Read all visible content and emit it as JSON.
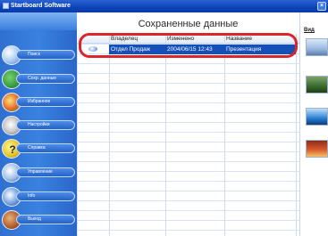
{
  "window": {
    "title": "Startboard Software",
    "close_label": "×"
  },
  "sidebar": {
    "items": [
      {
        "label": "Поиск",
        "icon": "search-icon"
      },
      {
        "label": "Сохр. данные",
        "icon": "saved-data-icon"
      },
      {
        "label": "Избранное",
        "icon": "favorites-icon"
      },
      {
        "label": "Настройки",
        "icon": "settings-icon"
      },
      {
        "label": "Справка",
        "icon": "help-icon",
        "glyph": "?"
      },
      {
        "label": "Управление",
        "icon": "manage-icon"
      },
      {
        "label": "Info",
        "icon": "info-icon"
      },
      {
        "label": "Выход",
        "icon": "exit-icon"
      }
    ]
  },
  "main": {
    "title": "Сохраненные данные",
    "columns": [
      "Владелец",
      "Изменено",
      "Название"
    ],
    "rows": [
      {
        "owner": "Отдел Продаж",
        "modified": "2004/06/15 12:43",
        "name": "Презентация",
        "selected": true
      }
    ]
  },
  "right_panel": {
    "label": "Вид"
  },
  "colors": {
    "selection": "#1450b8",
    "highlight_ring": "#d9262b",
    "sidebar": "#3a82e0",
    "titlebar": "#0d43b8"
  }
}
